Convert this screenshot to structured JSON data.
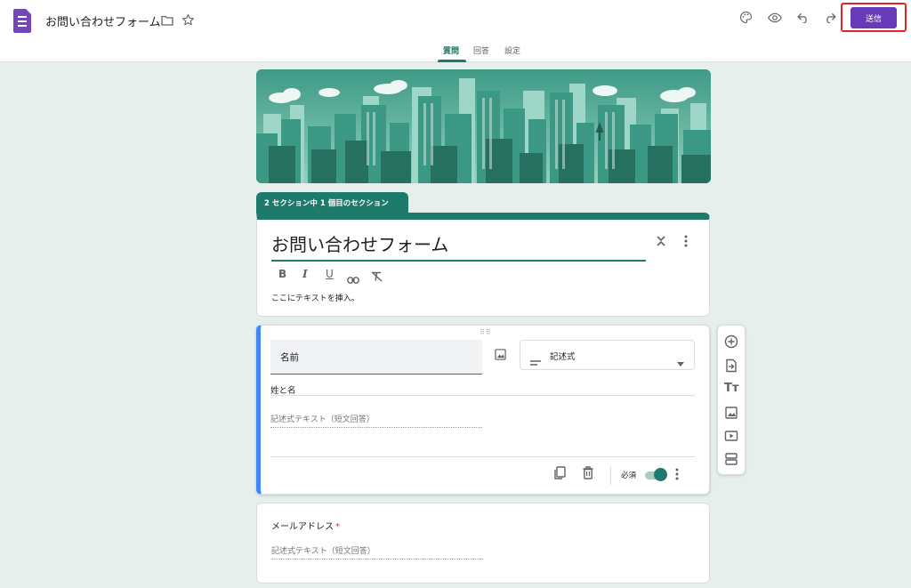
{
  "header": {
    "doc_title": "お問い合わせフォーム",
    "send_label": "送信",
    "icons": [
      "forms-logo-icon",
      "folder-icon",
      "star-icon",
      "palette-icon",
      "preview-eye-icon",
      "undo-icon",
      "redo-icon"
    ]
  },
  "tabs": [
    {
      "label": "質問",
      "active": true
    },
    {
      "label": "回答",
      "active": false
    },
    {
      "label": "設定",
      "active": false
    }
  ],
  "section_tab": "2 セクション中 1 個目のセクション",
  "title_card": {
    "title": "お問い合わせフォーム",
    "description": "ここにテキストを挿入。",
    "format_buttons": [
      "bold-icon",
      "italic-icon",
      "underline-icon",
      "link-icon",
      "clear-format-icon"
    ]
  },
  "question1": {
    "title": "名前",
    "type": "記述式",
    "description": "姓と名",
    "answer_placeholder": "記述式テキスト（短文回答）",
    "required_label": "必須",
    "required": true
  },
  "question2": {
    "title": "メールアドレス",
    "required_mark": "*",
    "answer_placeholder": "記述式テキスト（短文回答）"
  },
  "side_toolbar": [
    "add-question-icon",
    "import-questions-icon",
    "add-title-icon",
    "add-image-icon",
    "add-video-icon",
    "add-section-icon"
  ],
  "colors": {
    "theme": "#1e7a6a",
    "send": "#673ab7",
    "active_question": "#4285f4",
    "background": "#e6efec"
  }
}
